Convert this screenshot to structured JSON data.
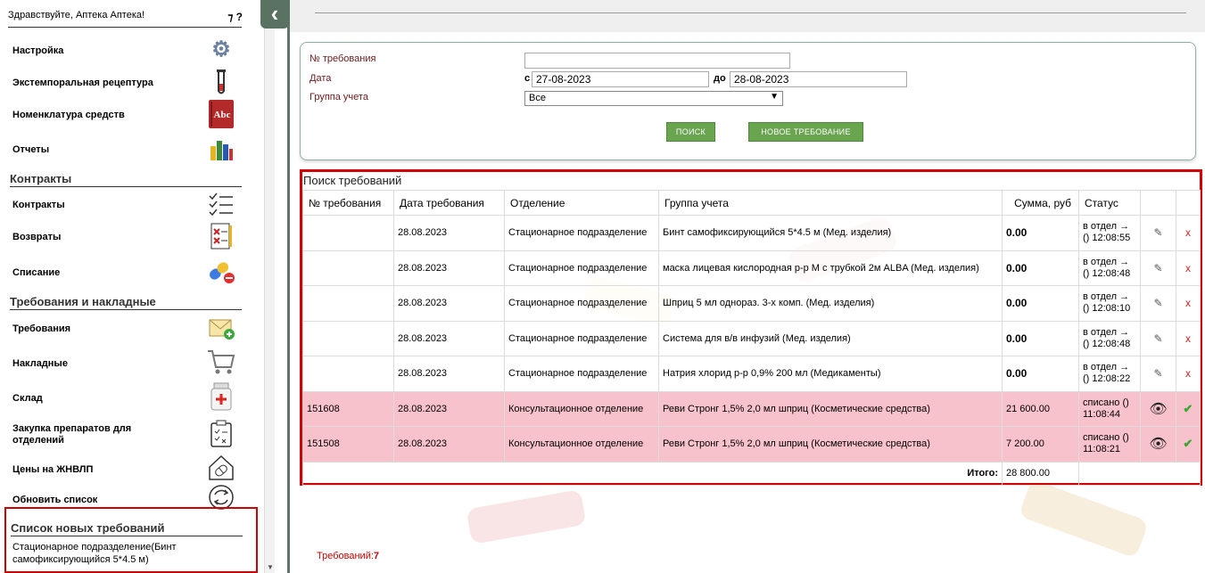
{
  "sidebar": {
    "greeting": "Здравствуйте, Аптека Аптека!",
    "help_icons": "?",
    "menu1": [
      {
        "label": "Настройка",
        "icon": "gear-icon"
      },
      {
        "label": "Экстемпоральная рецептура",
        "icon": "test-tube-icon"
      },
      {
        "label": "Номенклатура средств",
        "icon": "book-abc-icon",
        "icon_text": "Abc"
      },
      {
        "label": "Отчеты",
        "icon": "chart-icon"
      }
    ],
    "section_contracts": "Контракты",
    "menu2": [
      {
        "label": "Контракты",
        "icon": "checklist-icon"
      },
      {
        "label": "Возвраты",
        "icon": "return-document-icon"
      },
      {
        "label": "Списание",
        "icon": "pill-minus-icon"
      }
    ],
    "section_requests": "Требования и накладные",
    "menu3": [
      {
        "label": "Требования",
        "icon": "envelope-add-icon"
      },
      {
        "label": "Накладные",
        "icon": "cart-icon"
      },
      {
        "label": "Склад",
        "icon": "medicine-jar-icon"
      },
      {
        "label": "Закупка препаратов для отделений",
        "icon": "clipboard-icon"
      },
      {
        "label": "Цены на ЖНВЛП",
        "icon": "house-pill-icon"
      },
      {
        "label": "Обновить список",
        "icon": "refresh-icon"
      }
    ],
    "new_requests_title": "Список новых требований",
    "new_requests_item": "Стационарное подразделение(Бинт самофиксирующийся 5*4.5 м)"
  },
  "filter": {
    "number_label": "№ требования",
    "number_value": "",
    "date_label": "Дата",
    "from_label": "с",
    "date_from": "27-08-2023",
    "to_label": "до",
    "date_to": "28-08-2023",
    "group_label": "Группа учета",
    "group_value": "Все",
    "search_button": "ПОИСК",
    "new_button": "НОВОЕ ТРЕБОВАНИЕ"
  },
  "results": {
    "title": "Поиск требований",
    "columns": [
      "№ требования",
      "Дата требования",
      "Отделение",
      "Группа учета",
      "Сумма, руб",
      "Статус"
    ],
    "rows": [
      {
        "num": "",
        "date": "28.08.2023",
        "dept": "Стационарное подразделение",
        "group": "Бинт самофиксирующийся 5*4.5 м (Мед. изделия)",
        "sum": "0.00",
        "status": "в отдел → () 12:08:55",
        "done": false
      },
      {
        "num": "",
        "date": "28.08.2023",
        "dept": "Стационарное подразделение",
        "group": "маска лицевая кислородная р-р М с трубкой 2м ALBA (Мед. изделия)",
        "sum": "0.00",
        "status": "в отдел → () 12:08:48",
        "done": false
      },
      {
        "num": "",
        "date": "28.08.2023",
        "dept": "Стационарное подразделение",
        "group": "Шприц 5 мл однораз. 3-х комп. (Мед. изделия)",
        "sum": "0.00",
        "status": "в отдел → () 12:08:10",
        "done": false
      },
      {
        "num": "",
        "date": "28.08.2023",
        "dept": "Стационарное подразделение",
        "group": "Система для в/в инфузий (Мед. изделия)",
        "sum": "0.00",
        "status": "в отдел → () 12:08:48",
        "done": false
      },
      {
        "num": "",
        "date": "28.08.2023",
        "dept": "Стационарное подразделение",
        "group": "Натрия хлорид р-р 0,9% 200 мл (Медикаменты)",
        "sum": "0.00",
        "status": "в отдел → () 12:08:22",
        "done": false
      },
      {
        "num": "151608",
        "date": "28.08.2023",
        "dept": "Консультационное отделение",
        "group": "Реви Стронг 1,5% 2,0 мл шприц (Косметические средства)",
        "sum": "21 600.00",
        "status": "списано () 11:08:44",
        "done": true
      },
      {
        "num": "151508",
        "date": "28.08.2023",
        "dept": "Консультационное отделение",
        "group": "Реви Стронг 1,5% 2,0 мл шприц (Косметические средства)",
        "sum": "7 200.00",
        "status": "списано () 11:08:21",
        "done": true
      }
    ],
    "total_label": "Итого:",
    "total_value": "28 800.00"
  },
  "footer": {
    "count_label": "Требований:",
    "count_value": "7"
  },
  "colors": {
    "accent_green": "#69a44f",
    "highlight_red": "#d40000",
    "done_row": "#f8c2cc"
  }
}
